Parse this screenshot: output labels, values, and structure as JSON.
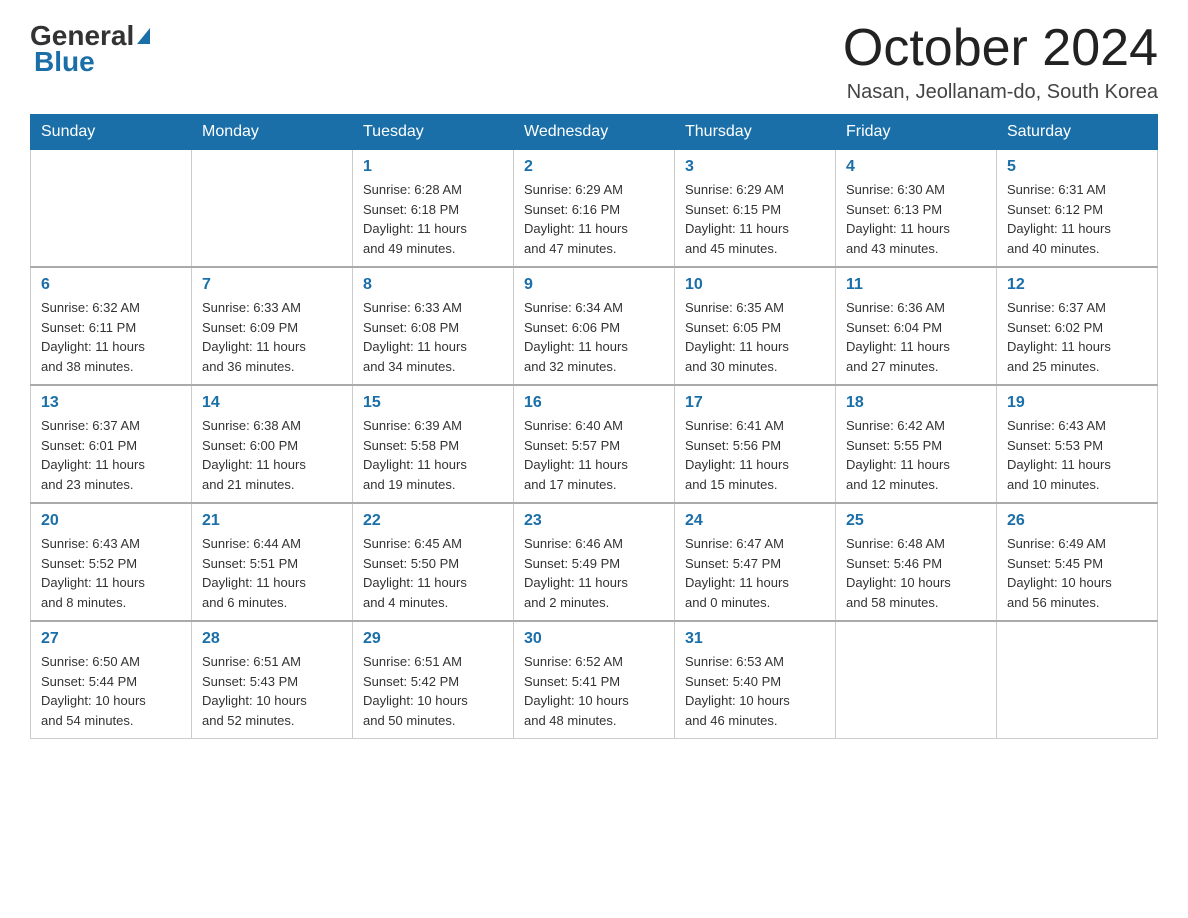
{
  "logo": {
    "general": "General",
    "blue": "Blue",
    "arrow": "▶"
  },
  "title": "October 2024",
  "subtitle": "Nasan, Jeollanam-do, South Korea",
  "days_of_week": [
    "Sunday",
    "Monday",
    "Tuesday",
    "Wednesday",
    "Thursday",
    "Friday",
    "Saturday"
  ],
  "weeks": [
    [
      {
        "day": "",
        "info": ""
      },
      {
        "day": "",
        "info": ""
      },
      {
        "day": "1",
        "info": "Sunrise: 6:28 AM\nSunset: 6:18 PM\nDaylight: 11 hours\nand 49 minutes."
      },
      {
        "day": "2",
        "info": "Sunrise: 6:29 AM\nSunset: 6:16 PM\nDaylight: 11 hours\nand 47 minutes."
      },
      {
        "day": "3",
        "info": "Sunrise: 6:29 AM\nSunset: 6:15 PM\nDaylight: 11 hours\nand 45 minutes."
      },
      {
        "day": "4",
        "info": "Sunrise: 6:30 AM\nSunset: 6:13 PM\nDaylight: 11 hours\nand 43 minutes."
      },
      {
        "day": "5",
        "info": "Sunrise: 6:31 AM\nSunset: 6:12 PM\nDaylight: 11 hours\nand 40 minutes."
      }
    ],
    [
      {
        "day": "6",
        "info": "Sunrise: 6:32 AM\nSunset: 6:11 PM\nDaylight: 11 hours\nand 38 minutes."
      },
      {
        "day": "7",
        "info": "Sunrise: 6:33 AM\nSunset: 6:09 PM\nDaylight: 11 hours\nand 36 minutes."
      },
      {
        "day": "8",
        "info": "Sunrise: 6:33 AM\nSunset: 6:08 PM\nDaylight: 11 hours\nand 34 minutes."
      },
      {
        "day": "9",
        "info": "Sunrise: 6:34 AM\nSunset: 6:06 PM\nDaylight: 11 hours\nand 32 minutes."
      },
      {
        "day": "10",
        "info": "Sunrise: 6:35 AM\nSunset: 6:05 PM\nDaylight: 11 hours\nand 30 minutes."
      },
      {
        "day": "11",
        "info": "Sunrise: 6:36 AM\nSunset: 6:04 PM\nDaylight: 11 hours\nand 27 minutes."
      },
      {
        "day": "12",
        "info": "Sunrise: 6:37 AM\nSunset: 6:02 PM\nDaylight: 11 hours\nand 25 minutes."
      }
    ],
    [
      {
        "day": "13",
        "info": "Sunrise: 6:37 AM\nSunset: 6:01 PM\nDaylight: 11 hours\nand 23 minutes."
      },
      {
        "day": "14",
        "info": "Sunrise: 6:38 AM\nSunset: 6:00 PM\nDaylight: 11 hours\nand 21 minutes."
      },
      {
        "day": "15",
        "info": "Sunrise: 6:39 AM\nSunset: 5:58 PM\nDaylight: 11 hours\nand 19 minutes."
      },
      {
        "day": "16",
        "info": "Sunrise: 6:40 AM\nSunset: 5:57 PM\nDaylight: 11 hours\nand 17 minutes."
      },
      {
        "day": "17",
        "info": "Sunrise: 6:41 AM\nSunset: 5:56 PM\nDaylight: 11 hours\nand 15 minutes."
      },
      {
        "day": "18",
        "info": "Sunrise: 6:42 AM\nSunset: 5:55 PM\nDaylight: 11 hours\nand 12 minutes."
      },
      {
        "day": "19",
        "info": "Sunrise: 6:43 AM\nSunset: 5:53 PM\nDaylight: 11 hours\nand 10 minutes."
      }
    ],
    [
      {
        "day": "20",
        "info": "Sunrise: 6:43 AM\nSunset: 5:52 PM\nDaylight: 11 hours\nand 8 minutes."
      },
      {
        "day": "21",
        "info": "Sunrise: 6:44 AM\nSunset: 5:51 PM\nDaylight: 11 hours\nand 6 minutes."
      },
      {
        "day": "22",
        "info": "Sunrise: 6:45 AM\nSunset: 5:50 PM\nDaylight: 11 hours\nand 4 minutes."
      },
      {
        "day": "23",
        "info": "Sunrise: 6:46 AM\nSunset: 5:49 PM\nDaylight: 11 hours\nand 2 minutes."
      },
      {
        "day": "24",
        "info": "Sunrise: 6:47 AM\nSunset: 5:47 PM\nDaylight: 11 hours\nand 0 minutes."
      },
      {
        "day": "25",
        "info": "Sunrise: 6:48 AM\nSunset: 5:46 PM\nDaylight: 10 hours\nand 58 minutes."
      },
      {
        "day": "26",
        "info": "Sunrise: 6:49 AM\nSunset: 5:45 PM\nDaylight: 10 hours\nand 56 minutes."
      }
    ],
    [
      {
        "day": "27",
        "info": "Sunrise: 6:50 AM\nSunset: 5:44 PM\nDaylight: 10 hours\nand 54 minutes."
      },
      {
        "day": "28",
        "info": "Sunrise: 6:51 AM\nSunset: 5:43 PM\nDaylight: 10 hours\nand 52 minutes."
      },
      {
        "day": "29",
        "info": "Sunrise: 6:51 AM\nSunset: 5:42 PM\nDaylight: 10 hours\nand 50 minutes."
      },
      {
        "day": "30",
        "info": "Sunrise: 6:52 AM\nSunset: 5:41 PM\nDaylight: 10 hours\nand 48 minutes."
      },
      {
        "day": "31",
        "info": "Sunrise: 6:53 AM\nSunset: 5:40 PM\nDaylight: 10 hours\nand 46 minutes."
      },
      {
        "day": "",
        "info": ""
      },
      {
        "day": "",
        "info": ""
      }
    ]
  ],
  "colors": {
    "header_bg": "#1a6fa8",
    "header_text": "#ffffff",
    "day_number": "#1a6fa8",
    "border": "#cccccc",
    "row_border": "#1a6fa8"
  }
}
